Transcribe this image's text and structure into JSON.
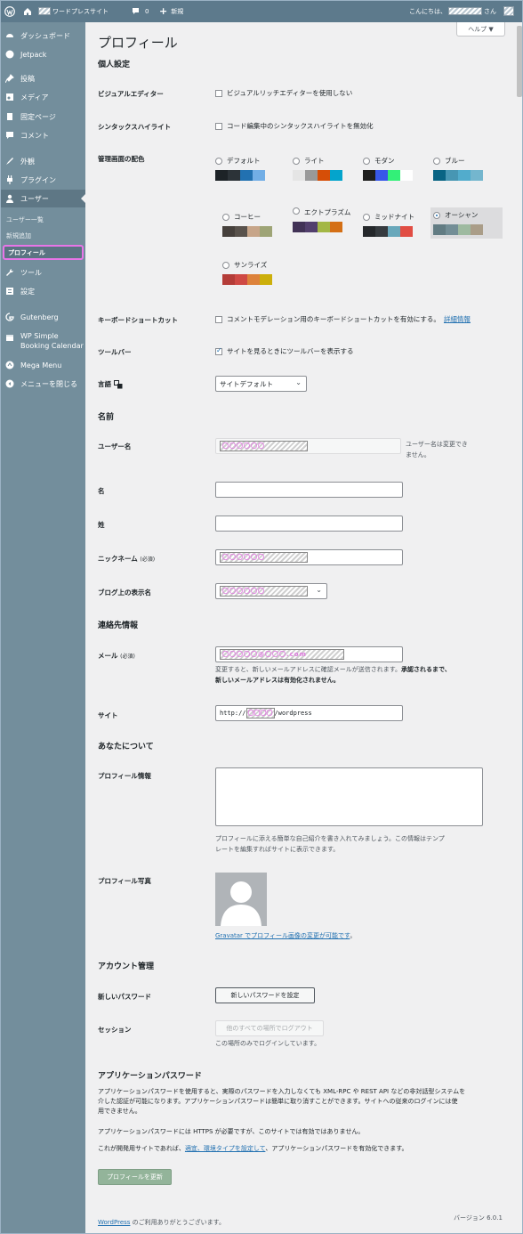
{
  "adminbar": {
    "site_name": "ワードプレスサイト",
    "comments_count": "0",
    "new_label": "新規",
    "greeting": "こんにちは、",
    "greeting_suffix": "さん"
  },
  "sidebar": {
    "items": [
      {
        "label": "ダッシュボード",
        "icon": "dashboard-icon"
      },
      {
        "label": "Jetpack",
        "icon": "jetpack-icon"
      },
      {
        "label": "投稿",
        "icon": "pin-icon"
      },
      {
        "label": "メディア",
        "icon": "media-icon"
      },
      {
        "label": "固定ページ",
        "icon": "page-icon"
      },
      {
        "label": "コメント",
        "icon": "comment-icon"
      },
      {
        "label": "外観",
        "icon": "brush-icon"
      },
      {
        "label": "プラグイン",
        "icon": "plugin-icon"
      },
      {
        "label": "ユーザー",
        "icon": "users-icon"
      },
      {
        "label": "ツール",
        "icon": "tools-icon"
      },
      {
        "label": "設定",
        "icon": "settings-icon"
      },
      {
        "label": "Gutenberg",
        "icon": "gutenberg-icon"
      },
      {
        "label": "WP Simple",
        "label2": "Booking Calendar",
        "icon": "calendar-icon"
      },
      {
        "label": "Mega Menu",
        "icon": "megamenu-icon"
      },
      {
        "label": "メニューを閉じる",
        "icon": "collapse-icon"
      }
    ],
    "subitems": [
      "ユーザー一覧",
      "新規追加",
      "プロフィール"
    ]
  },
  "help_label": "ヘルプ ▼",
  "page_title": "プロフィール",
  "personal": {
    "heading": "個人設定",
    "visual_editor_label": "ビジュアルエディター",
    "visual_editor_cb": "ビジュアルリッチエディターを使用しない",
    "syntax_label": "シンタックスハイライト",
    "syntax_cb": "コード編集中のシンタックスハイライトを無効化",
    "scheme_label": "管理画面の配色",
    "schemes": [
      {
        "name": "デフォルト",
        "colors": [
          "#1d2327",
          "#2c3338",
          "#2271b1",
          "#72aee6"
        ],
        "selected": false
      },
      {
        "name": "ライト",
        "colors": [
          "#e5e5e5",
          "#999999",
          "#d64e07",
          "#04a4cc"
        ],
        "selected": false
      },
      {
        "name": "モダン",
        "colors": [
          "#1e1e1e",
          "#3858e9",
          "#33f078",
          "#ffffff"
        ],
        "selected": false
      },
      {
        "name": "ブルー",
        "colors": [
          "#096484",
          "#4796b3",
          "#52accc",
          "#74b6ce"
        ],
        "selected": false
      },
      {
        "name": "コーヒー",
        "colors": [
          "#46403c",
          "#59524c",
          "#c7a589",
          "#9ea476"
        ],
        "selected": false
      },
      {
        "name": "エクトプラズム",
        "colors": [
          "#413256",
          "#523f6d",
          "#a3b745",
          "#d46f15"
        ],
        "selected": false
      },
      {
        "name": "ミッドナイト",
        "colors": [
          "#25282b",
          "#363b3f",
          "#69a8bb",
          "#e14d43"
        ],
        "selected": false
      },
      {
        "name": "オーシャン",
        "colors": [
          "#627c83",
          "#738e96",
          "#9ebaa0",
          "#aa9d88"
        ],
        "selected": true
      },
      {
        "name": "サンライズ",
        "colors": [
          "#b43c38",
          "#cf4944",
          "#dd823b",
          "#ccaf0b"
        ],
        "selected": false
      }
    ],
    "shortcuts_label": "キーボードショートカット",
    "shortcuts_cb": "コメントモデレーション用のキーボードショートカットを有効にする。",
    "shortcuts_link": "詳細情報",
    "toolbar_label": "ツールバー",
    "toolbar_cb": "サイトを見るときにツールバーを表示する",
    "language_label": "言語",
    "language_value": "サイトデフォルト"
  },
  "name": {
    "heading": "名前",
    "username_label": "ユーザー名",
    "username_mask": "〇〇〇〇〇〇",
    "username_note": "ユーザー名は変更できません。",
    "first_label": "名",
    "last_label": "姓",
    "nickname_label": "ニックネーム",
    "required": "(必須)",
    "nickname_mask": "〇〇〇〇〇〇",
    "display_label": "ブログ上の表示名",
    "display_mask": "〇〇〇〇〇〇"
  },
  "contact": {
    "heading": "連絡先情報",
    "email_label": "メール",
    "required": "(必須)",
    "email_mask": "〇〇〇〇〇@〇〇〇.com",
    "email_note1": "変更すると、新しいメールアドレスに確認メールが送信されます。",
    "email_note_bold1": "承認されるまで、",
    "email_note_bold2": "新しいメールアドレスは有効化されません。",
    "site_label": "サイト",
    "site_prefix": "http://",
    "site_mask": "〇〇〇〇",
    "site_suffix": "/wordpress"
  },
  "about": {
    "heading": "あなたについて",
    "bio_label": "プロフィール情報",
    "bio_note1": "プロフィールに添える簡単な自己紹介を書き入れてみましょう。この情報はテンプ",
    "bio_note2": "レートを編集すればサイトに表示できます。",
    "photo_label": "プロフィール写真",
    "gravatar_link": "Gravatar でプロフィール画像の変更が可能です",
    "gravatar_end": "。"
  },
  "account": {
    "heading": "アカウント管理",
    "newpass_label": "新しいパスワード",
    "newpass_button": "新しいパスワードを設定",
    "session_label": "セッション",
    "logout_button": "他のすべての場所でログアウト",
    "session_note": "この場所のみでログインしています。"
  },
  "apppass": {
    "heading": "アプリケーションパスワード",
    "p1a": "アプリケーションパスワードを使用すると、実際のパスワードを入力しなくても XML-RPC や REST API などの非対話型システムを",
    "p1b": "介した認証が可能になります。アプリケーションパスワードは簡単に取り消すことができます。サイトへの従来のログインには使",
    "p1c": "用できません。",
    "p2": "アプリケーションパスワードには HTTPS が必要ですが、このサイトでは有効ではありません。",
    "p3a": "これが開発用サイトであれば、",
    "p3link": "適宜、環境タイプを設定して",
    "p3b": "、アプリケーションパスワードを有効化できます。"
  },
  "submit_label": "プロフィールを更新",
  "footer": {
    "wp_link": "WordPress",
    "thanks": " のご利用ありがとうございます。",
    "version": "バージョン 6.0.1"
  }
}
